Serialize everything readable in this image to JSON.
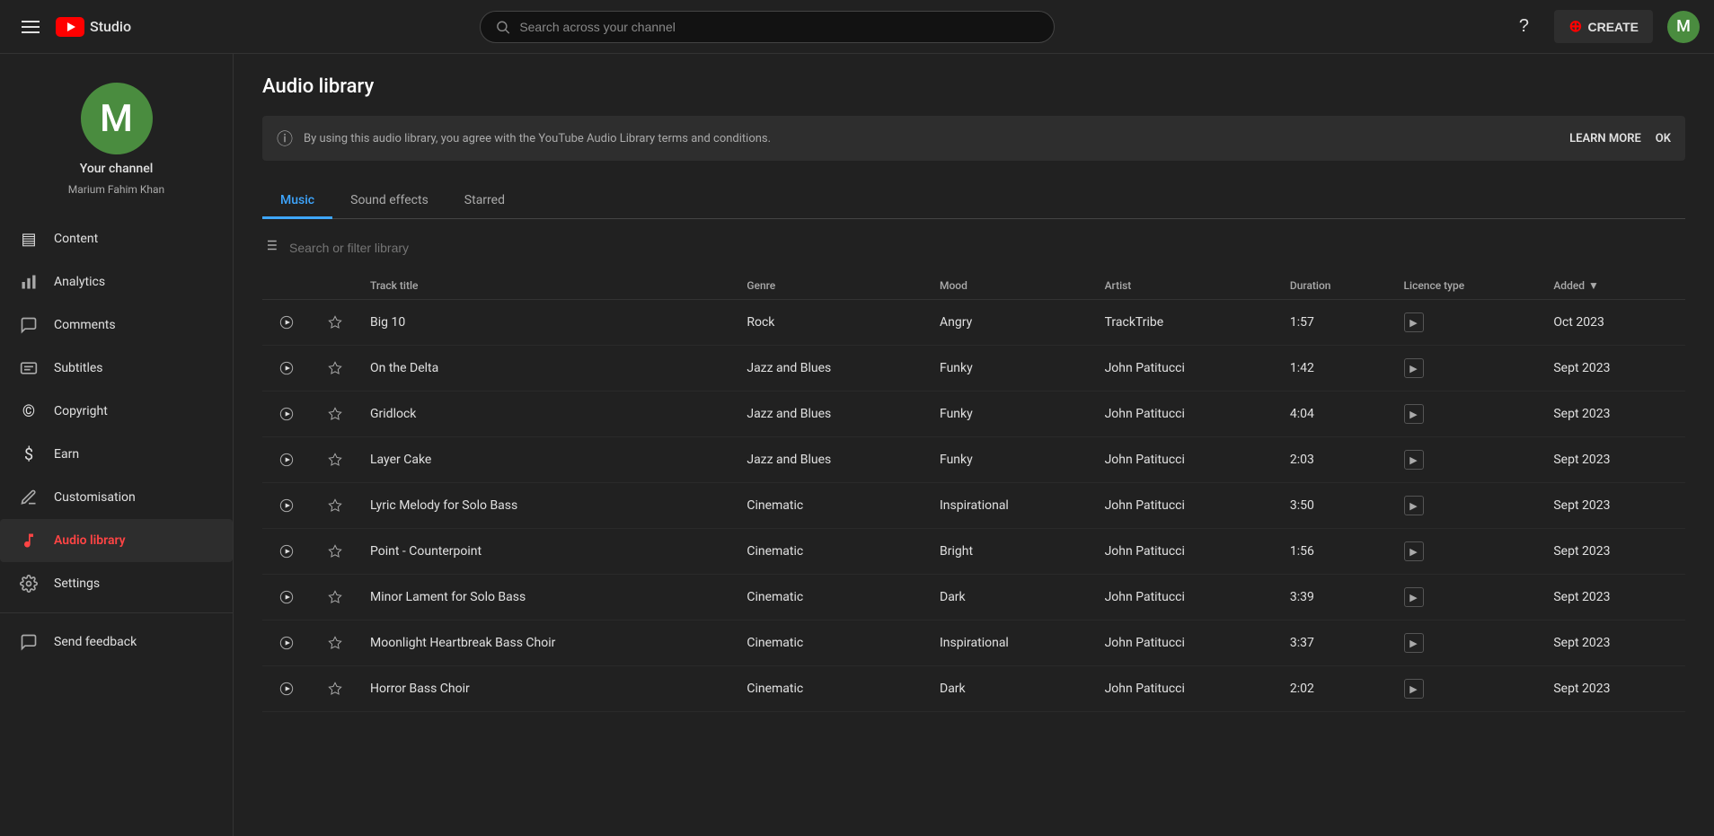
{
  "topbar": {
    "search_placeholder": "Search across your channel",
    "create_label": "CREATE",
    "avatar_letter": "M"
  },
  "sidebar": {
    "channel_avatar_letter": "M",
    "channel_name": "Your channel",
    "channel_handle": "Marium Fahim Khan",
    "nav_items": [
      {
        "id": "content",
        "label": "Content",
        "icon": "▤"
      },
      {
        "id": "analytics",
        "label": "Analytics",
        "icon": "📊"
      },
      {
        "id": "comments",
        "label": "Comments",
        "icon": "💬"
      },
      {
        "id": "subtitles",
        "label": "Subtitles",
        "icon": "⊟"
      },
      {
        "id": "copyright",
        "label": "Copyright",
        "icon": "©"
      },
      {
        "id": "earn",
        "label": "Earn",
        "icon": "＄"
      },
      {
        "id": "customisation",
        "label": "Customisation",
        "icon": "✦"
      },
      {
        "id": "audio-library",
        "label": "Audio library",
        "icon": "🎵",
        "active": true
      },
      {
        "id": "settings",
        "label": "Settings",
        "icon": "⚙"
      },
      {
        "id": "send-feedback",
        "label": "Send feedback",
        "icon": "⚑"
      }
    ]
  },
  "page": {
    "title": "Audio library",
    "info_text": "By using this audio library, you agree with the YouTube Audio Library terms and conditions.",
    "learn_more_label": "LEARN MORE",
    "ok_label": "OK"
  },
  "tabs": [
    {
      "id": "music",
      "label": "Music",
      "active": true
    },
    {
      "id": "sound-effects",
      "label": "Sound effects",
      "active": false
    },
    {
      "id": "starred",
      "label": "Starred",
      "active": false
    }
  ],
  "filter": {
    "placeholder": "Search or filter library"
  },
  "table": {
    "columns": [
      {
        "id": "track-title",
        "label": "Track title"
      },
      {
        "id": "genre",
        "label": "Genre"
      },
      {
        "id": "mood",
        "label": "Mood"
      },
      {
        "id": "artist",
        "label": "Artist"
      },
      {
        "id": "duration",
        "label": "Duration"
      },
      {
        "id": "licence-type",
        "label": "Licence type"
      },
      {
        "id": "added",
        "label": "Added"
      }
    ],
    "rows": [
      {
        "title": "Big 10",
        "genre": "Rock",
        "mood": "Angry",
        "artist": "TrackTribe",
        "duration": "1:57",
        "added": "Oct 2023"
      },
      {
        "title": "On the Delta",
        "genre": "Jazz and Blues",
        "mood": "Funky",
        "artist": "John Patitucci",
        "duration": "1:42",
        "added": "Sept 2023"
      },
      {
        "title": "Gridlock",
        "genre": "Jazz and Blues",
        "mood": "Funky",
        "artist": "John Patitucci",
        "duration": "4:04",
        "added": "Sept 2023"
      },
      {
        "title": "Layer Cake",
        "genre": "Jazz and Blues",
        "mood": "Funky",
        "artist": "John Patitucci",
        "duration": "2:03",
        "added": "Sept 2023"
      },
      {
        "title": "Lyric Melody for Solo Bass",
        "genre": "Cinematic",
        "mood": "Inspirational",
        "artist": "John Patitucci",
        "duration": "3:50",
        "added": "Sept 2023"
      },
      {
        "title": "Point - Counterpoint",
        "genre": "Cinematic",
        "mood": "Bright",
        "artist": "John Patitucci",
        "duration": "1:56",
        "added": "Sept 2023"
      },
      {
        "title": "Minor Lament for Solo Bass",
        "genre": "Cinematic",
        "mood": "Dark",
        "artist": "John Patitucci",
        "duration": "3:39",
        "added": "Sept 2023"
      },
      {
        "title": "Moonlight Heartbreak Bass Choir",
        "genre": "Cinematic",
        "mood": "Inspirational",
        "artist": "John Patitucci",
        "duration": "3:37",
        "added": "Sept 2023"
      },
      {
        "title": "Horror Bass Choir",
        "genre": "Cinematic",
        "mood": "Dark",
        "artist": "John Patitucci",
        "duration": "2:02",
        "added": "Sept 2023"
      }
    ]
  }
}
